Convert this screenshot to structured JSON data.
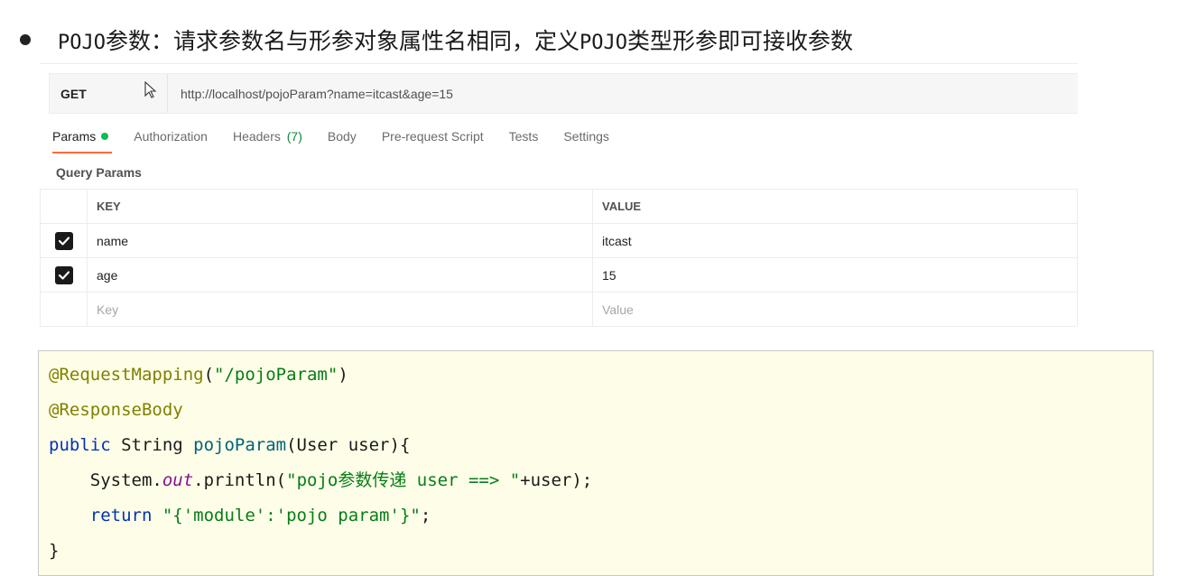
{
  "heading": {
    "prefix": "POJO",
    "text1": "参数：请求参数名与形参对象属性名相同，定义",
    "mono2": "POJO",
    "text2": "类型形参即可接收参数"
  },
  "request": {
    "method": "GET",
    "url": "http://localhost/pojoParam?name=itcast&age=15"
  },
  "tabs": [
    {
      "label": "Params",
      "active": true
    },
    {
      "label": "Authorization"
    },
    {
      "label": "Headers",
      "count": "(7)"
    },
    {
      "label": "Body"
    },
    {
      "label": "Pre-request Script"
    },
    {
      "label": "Tests"
    },
    {
      "label": "Settings"
    }
  ],
  "query_params": {
    "title": "Query Params",
    "header_key": "KEY",
    "header_value": "VALUE",
    "rows": [
      {
        "key": "name",
        "value": "itcast"
      },
      {
        "key": "age",
        "value": "15"
      }
    ],
    "placeholder_key": "Key",
    "placeholder_value": "Value"
  },
  "code": {
    "l1_ann": "@RequestMapping",
    "l1_open": "(",
    "l1_str": "\"/pojoParam\"",
    "l1_close": ")",
    "l2_ann": "@ResponseBody",
    "l3_kw": "public",
    "l3_type": " String ",
    "l3_fn": "pojoParam",
    "l3_rest": "(User user){",
    "l4_indent": "    System.",
    "l4_out": "out",
    "l4_call": ".println(",
    "l4_str": "\"pojo参数传递 user ==> \"",
    "l4_rest": "+user);",
    "l5_kw": "    return ",
    "l5_str": "\"{'module':'pojo param'}\"",
    "l5_rest": ";",
    "l6": "}"
  }
}
